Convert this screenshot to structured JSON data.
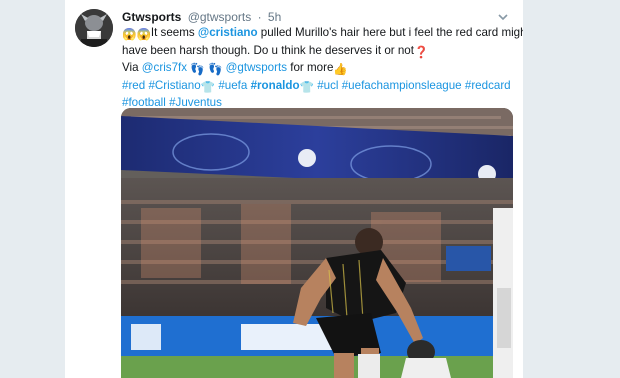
{
  "tweet": {
    "display_name": "Gtwsports",
    "handle": "@gtwsports",
    "separator": "·",
    "time": "5h",
    "line1": {
      "emoji": [
        "😱",
        "😱"
      ],
      "t1": "It seems ",
      "mention": "@cristiano",
      "t2": " pulled Murillo's hair here but i feel the red card might"
    },
    "line2": {
      "text": "have been harsh though. Do u think he deserves it or not",
      "emoji": "❓"
    },
    "line3": {
      "via": "Via ",
      "mention1": "@cris7fx",
      "emoji": "👣",
      "mention2": "@gtwsports",
      "more": " for more",
      "emoji2": "👍"
    },
    "line4": {
      "h1": "#red",
      "h2": "#Cristiano",
      "emoji": "👕",
      "h3": "#uefa",
      "h4": "#ronaldo",
      "h5": "#ucl",
      "h6": "#uefachampionsleague",
      "h7": "#redcard"
    },
    "line5": {
      "h1": "#football",
      "h2": "#Juventus"
    }
  },
  "colors": {
    "link": "#1b95e0",
    "text": "#14171a",
    "muted": "#657786",
    "background": "#e6ecf0"
  },
  "icons": {
    "caret": "chevron-down-icon",
    "avatar": "avatar-image"
  }
}
